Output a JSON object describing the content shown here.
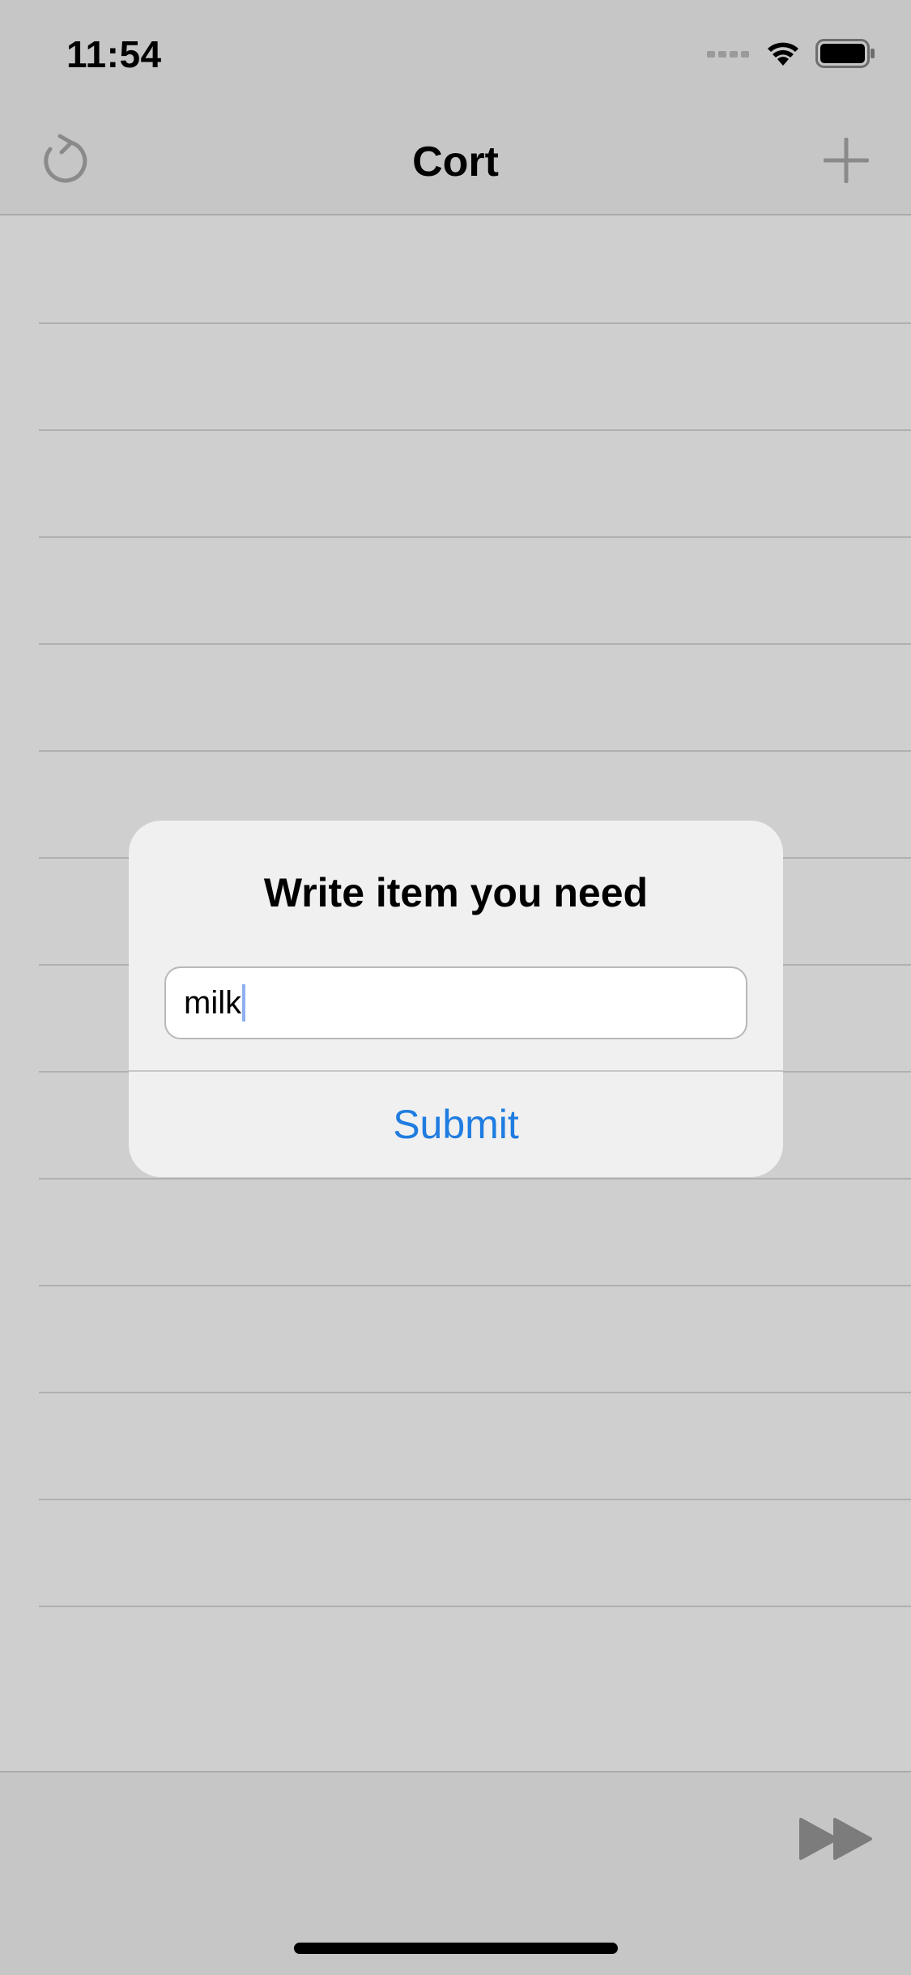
{
  "status_bar": {
    "time": "11:54",
    "icons": [
      "cellular-signal-icon",
      "wifi-icon",
      "battery-icon"
    ]
  },
  "nav": {
    "title": "Cort",
    "left_icon": "refresh-icon",
    "right_icon": "plus-icon"
  },
  "table": {
    "rows": [
      "",
      "",
      "",
      "",
      "",
      "",
      "",
      "",
      "",
      "",
      "",
      "",
      "",
      ""
    ]
  },
  "alert": {
    "title": "Write item you need",
    "input_value": "milk",
    "submit_label": "Submit"
  },
  "toolbar": {
    "right_icon": "fast-forward-icon"
  },
  "colors": {
    "accent": "#1f7ce0",
    "bar_bg": "#c6c6c6",
    "content_bg": "#cfcfcf",
    "alert_bg": "#f0f0f0"
  }
}
